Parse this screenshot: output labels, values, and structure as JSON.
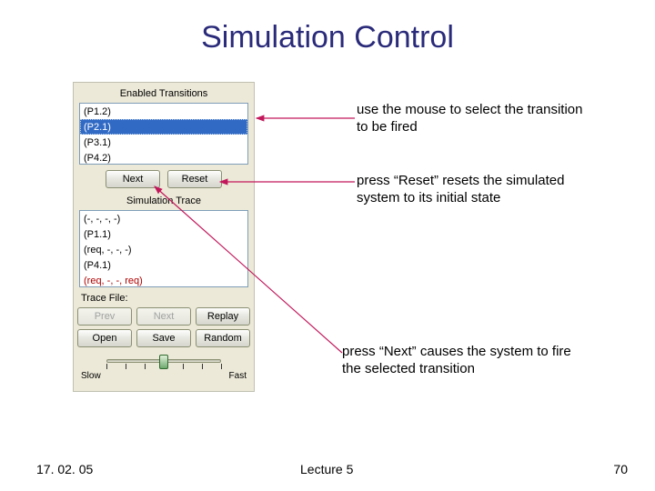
{
  "title": "Simulation Control",
  "panel": {
    "enabled_heading": "Enabled Transitions",
    "enabled_items": [
      "(P1.2)",
      "(P2.1)",
      "(P3.1)",
      "(P4.2)"
    ],
    "enabled_selected_index": 1,
    "next_btn": "Next",
    "reset_btn": "Reset",
    "trace_heading": "Simulation Trace",
    "trace_items": [
      "(-, -, -, -)",
      "(P1.1)",
      "(req, -, -, -)",
      "(P4.1)",
      "(req, -, -, req)"
    ],
    "trace_red_index": 4,
    "trace_file_label": "Trace File:",
    "buttons": [
      "Prev",
      "Next",
      "Replay",
      "Open",
      "Save",
      "Random"
    ],
    "disabled": [
      true,
      true,
      false,
      false,
      false,
      false
    ],
    "slow": "Slow",
    "fast": "Fast"
  },
  "annotations": {
    "a1": "use the mouse to select the transition to be fired",
    "a2": "press “Reset” resets the simulated system to its initial state",
    "a3": "press “Next” causes the system to fire the selected transition"
  },
  "footer": {
    "date": "17. 02. 05",
    "center": "Lecture 5",
    "pagenum": "70"
  }
}
